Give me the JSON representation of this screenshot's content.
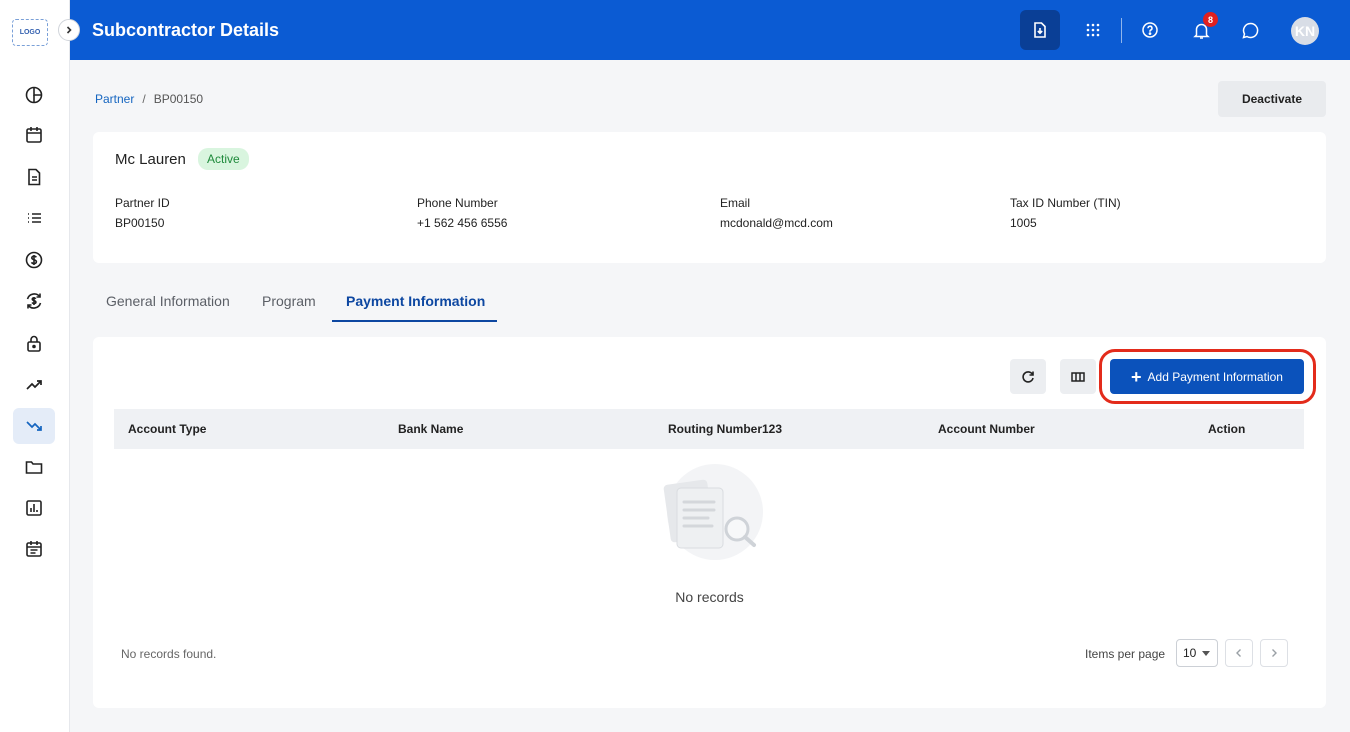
{
  "app": {
    "logo_text": "LOGO",
    "title": "Subcontractor Details",
    "accent_color": "#0b5bd3"
  },
  "header": {
    "icons": [
      "download-icon",
      "apps-grid-icon",
      "help-icon",
      "bell-icon",
      "chat-icon"
    ],
    "notification_count": "8",
    "avatar_initials": "KN"
  },
  "sidebar": {
    "items": [
      {
        "icon": "pie-chart-icon",
        "active": false
      },
      {
        "icon": "calendar-icon",
        "active": false
      },
      {
        "icon": "document-icon",
        "active": false
      },
      {
        "icon": "list-icon",
        "active": false
      },
      {
        "icon": "dollar-icon",
        "active": false
      },
      {
        "icon": "currency-exchange-icon",
        "active": false
      },
      {
        "icon": "lock-icon",
        "active": false
      },
      {
        "icon": "trending-up-icon",
        "active": false
      },
      {
        "icon": "trending-down-icon",
        "active": true
      },
      {
        "icon": "folder-icon",
        "active": false
      },
      {
        "icon": "bar-chart-icon",
        "active": false
      },
      {
        "icon": "event-note-icon",
        "active": false
      }
    ]
  },
  "breadcrumb": {
    "parent": "Partner",
    "separator": "/",
    "current": "BP00150"
  },
  "actions": {
    "deactivate": "Deactivate"
  },
  "partner": {
    "name": "Mc Lauren",
    "status": "Active",
    "fields": [
      {
        "label": "Partner ID",
        "value": "BP00150"
      },
      {
        "label": "Phone Number",
        "value": "+1 562 456 6556"
      },
      {
        "label": "Email",
        "value": "mcdonald@mcd.com"
      },
      {
        "label": "Tax ID Number (TIN)",
        "value": "1005"
      }
    ]
  },
  "tabs": [
    {
      "label": "General Information",
      "active": false
    },
    {
      "label": "Program",
      "active": false
    },
    {
      "label": "Payment Information",
      "active": true
    }
  ],
  "table": {
    "add_button": "Add Payment Information",
    "columns": [
      "Account Type",
      "Bank Name",
      "Routing Number123",
      "Account Number",
      "Action"
    ],
    "rows": [],
    "empty_message": "No records",
    "footer_status": "No records found.",
    "items_per_page_label": "Items per page",
    "items_per_page_value": "10"
  }
}
